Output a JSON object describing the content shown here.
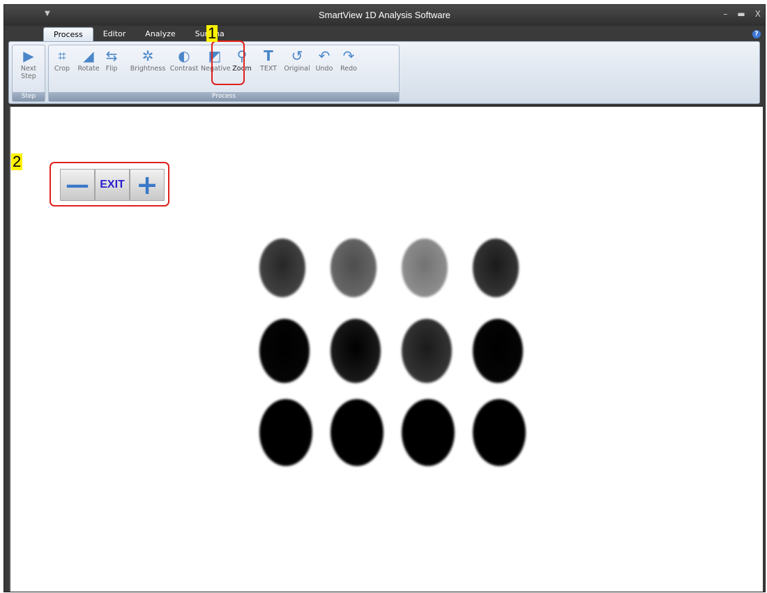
{
  "window": {
    "title": "SmartView 1D Analysis Software",
    "controls": [
      "–",
      "▬",
      "X"
    ]
  },
  "tabs": [
    {
      "label": "Process",
      "active": true
    },
    {
      "label": "Editor",
      "active": false
    },
    {
      "label": "Analyze",
      "active": false
    },
    {
      "label": "Summa",
      "active": false
    }
  ],
  "ribbon": {
    "groups": [
      {
        "label": "Step",
        "buttons": [
          {
            "label": "Next Step",
            "icon": "play-icon"
          }
        ]
      },
      {
        "label": "Process",
        "buttons": [
          {
            "label": "Crop",
            "icon": "crop-icon"
          },
          {
            "label": "Rotate",
            "icon": "rotate-icon"
          },
          {
            "label": "Flip",
            "icon": "flip-icon"
          },
          {
            "label": "Brightness",
            "icon": "brightness-icon"
          },
          {
            "label": "Contrast",
            "icon": "contrast-icon"
          },
          {
            "label": "Negative",
            "icon": "negative-icon"
          },
          {
            "label": "Zoom",
            "icon": "zoom-icon"
          },
          {
            "label": "TEXT",
            "icon": "text-icon"
          },
          {
            "label": "Original",
            "icon": "original-icon"
          },
          {
            "label": "Undo",
            "icon": "undo-icon"
          },
          {
            "label": "Redo",
            "icon": "redo-icon"
          }
        ]
      }
    ]
  },
  "annotations": {
    "marker1": "1",
    "marker2": "2"
  },
  "zoom_toolbar": {
    "minus": "—",
    "exit": "EXIT",
    "plus": "+"
  },
  "colors": {
    "highlight": "#e0201a",
    "marker_bg": "#fff200",
    "accent": "#3a78c8"
  },
  "blot": {
    "rows": 3,
    "cols": 4,
    "intensities": [
      [
        0.75,
        0.6,
        0.45,
        0.8
      ],
      [
        0.98,
        0.9,
        0.8,
        0.98
      ],
      [
        1.0,
        1.0,
        1.0,
        1.0
      ]
    ]
  }
}
